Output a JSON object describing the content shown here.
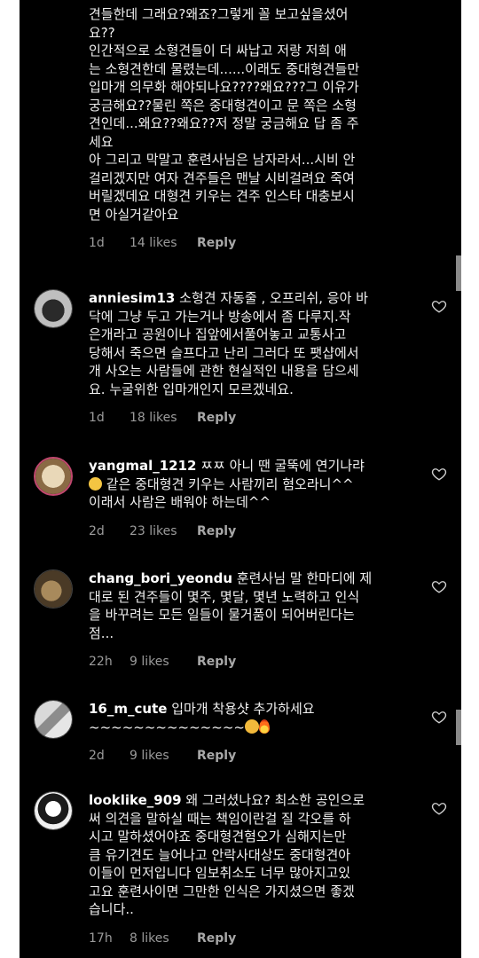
{
  "comments": [
    {
      "user": "",
      "text": "견들한데 그래요?왜죠?그렇게 꼴 보고싶을셨어\n요??\n인간적으로 소형견들이 더 싸납고 저랑 저희 애\n는 소형견한데 물렸는데......이래도 중대형견들만\n입마개 의무화 해야되나요????왜요???그 이유가\n궁금해요??물린 쪽은 중대형견이고 문 쪽은 소형\n견인데...왜요??왜요??저 정말 궁금해요 답 좀 주\n세요\n아 그리고 막말고 훈련사님은 남자라서...시비 안\n걸리겠지만 여자 견주들은 맨날 시비걸려요 죽여\n버릴겠데요 대형견 키우는 견주 인스타 대충보시\n면 아실거같아요",
      "time": "1d",
      "likes": "14 likes",
      "reply": "Reply"
    },
    {
      "user": "anniesim13",
      "text": "소형견 자동줄 , 오프리쉬, 응아 바\n닥에 그냥 두고 가는거나 방송에서 좀 다루지.작\n은개라고 공원이나 집앞에서풀어놓고 교통사고\n당해서 죽으면 슬프다고 난리 그러다 또 팻샵에서\n개 사오는 사람들에 관한 현실적인 내용을 담으세\n요. 누굴위한 입마개인지 모르겠네요.",
      "time": "1d",
      "likes": "18 likes",
      "reply": "Reply"
    },
    {
      "user": "yangmal_1212",
      "text_line1": "ㅉㅉ 아니 땐 굴뚝에 연기나랴",
      "text_line2": " 같은 중대형견 키우는 사람끼리 혐오라니^^",
      "text_line3": "이래서 사람은 배워야 하는데^^",
      "time": "2d",
      "likes": "23 likes",
      "reply": "Reply"
    },
    {
      "user": "chang_bori_yeondu",
      "text": "훈련사님 말 한마디에 제\n대로 된 견주들이 몇주, 몇달, 몇년 노력하고 인식\n을 바꾸려는 모든 일들이 물거품이 되어버린다는\n점...",
      "time": "22h",
      "likes": "9 likes",
      "reply": "Reply"
    },
    {
      "user": "16_m_cute",
      "text_line1": "입마개 착용샷 추가하세요",
      "text_line2": "~~~~~~~~~~~~~~",
      "time": "2d",
      "likes": "9 likes",
      "reply": "Reply"
    },
    {
      "user": "looklike_909",
      "text": "왜 그러셨나요? 최소한 공인으로\n써 의견을 말하실 때는 책임이란걸 질 각오를 하\n시고 말하셨어야죠 중대형견혐오가 심해지는만\n큼 유기견도 늘어나고 안락사대상도 중대형견아\n이들이 먼저입니다 임보취소도 너무 많아지고있\n고요 훈련사이면 그만한 인식은 가지셨으면 좋겠\n습니다..",
      "time": "17h",
      "likes": "8 likes",
      "reply": "Reply"
    }
  ],
  "icons": {
    "like": "heart-outline-icon",
    "smile_emoji": "smiling-face-emoji",
    "blush_emoji": "smiling-blush-emoji",
    "fire_emoji": "fire-emoji"
  },
  "colors": {
    "background": "#000000",
    "text": "#f1f1f1",
    "meta": "#9b9b9b"
  }
}
